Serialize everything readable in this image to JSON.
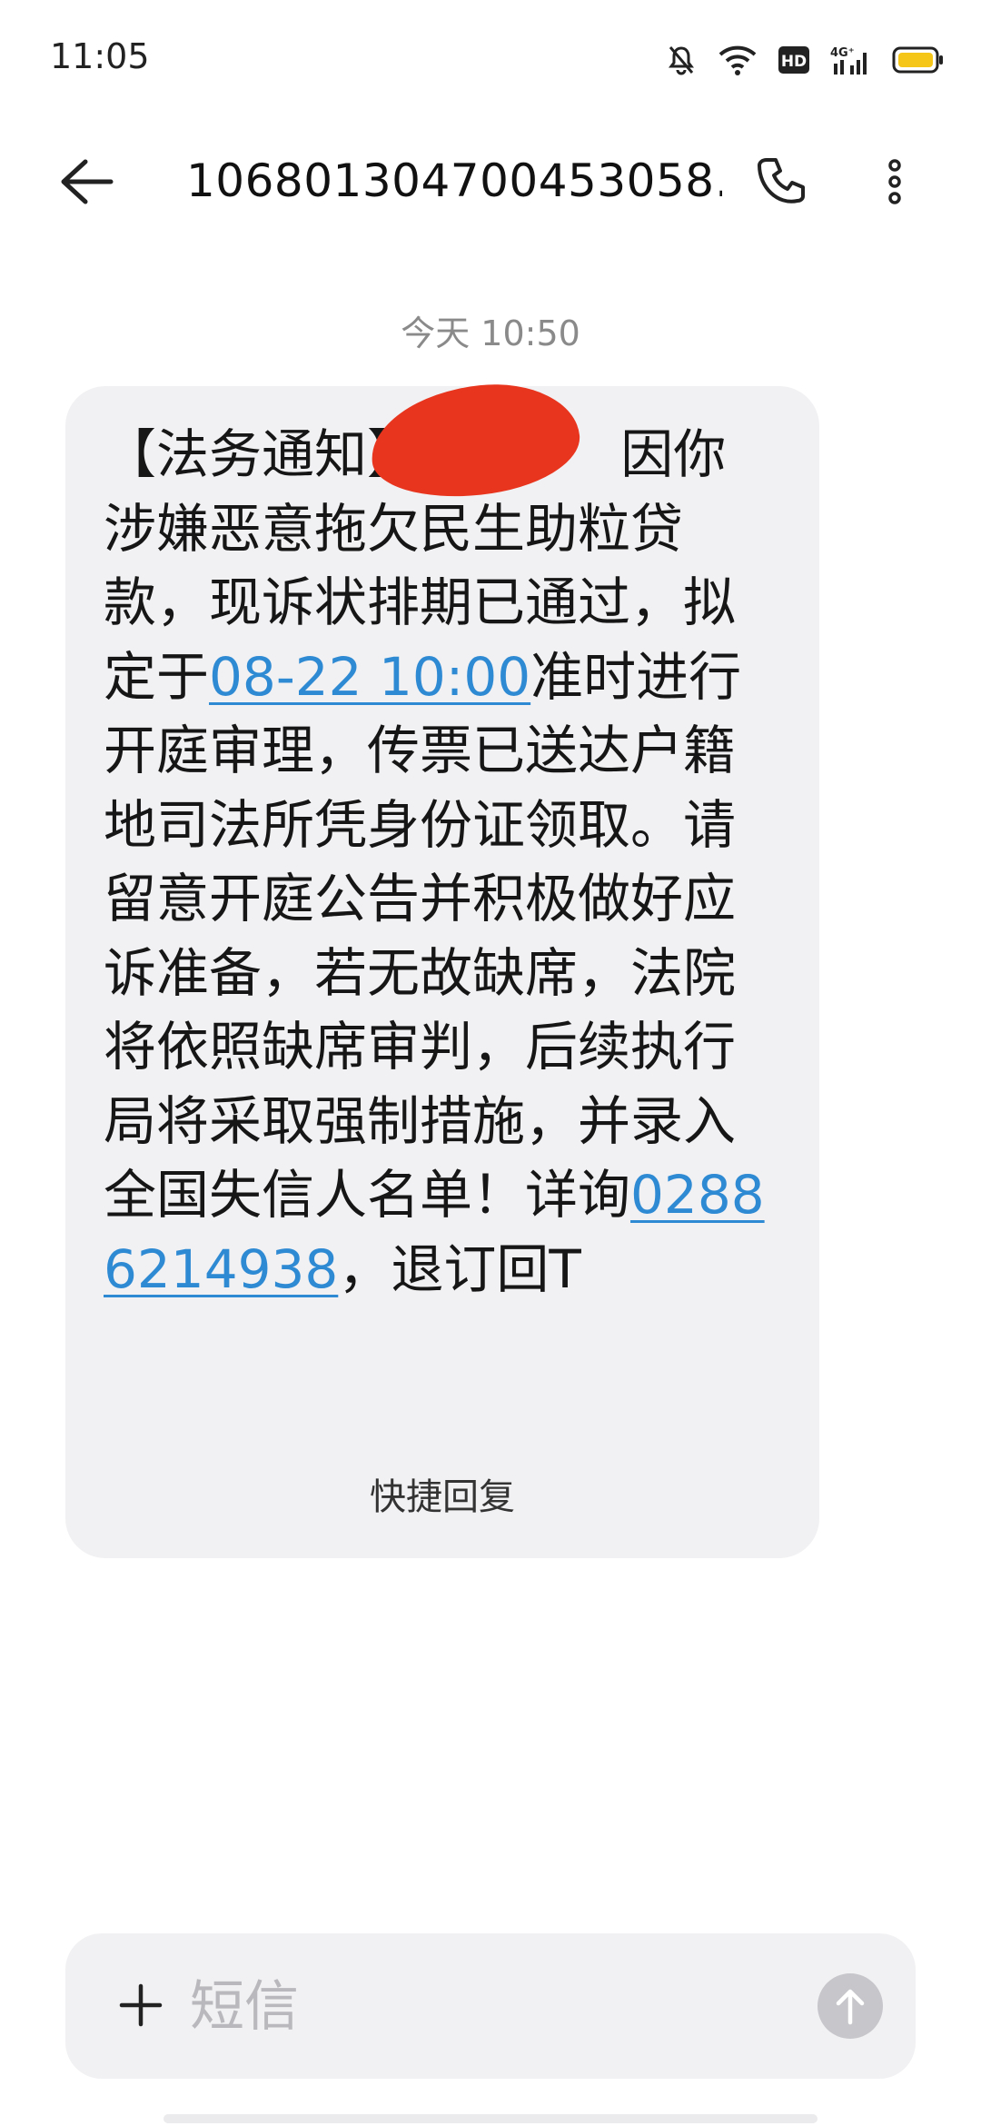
{
  "status_bar": {
    "time": "11:05",
    "icons": [
      "mute-bell-icon",
      "wifi-icon",
      "hd-icon",
      "signal-4g-icon",
      "battery-icon"
    ],
    "hd_label": "HD",
    "network_label": "4G⁺",
    "battery_color": "#f5c518"
  },
  "header": {
    "back_icon": "arrow-left-icon",
    "title": "106801304700453058…",
    "call_icon": "phone-icon",
    "more_icon": "more-vertical-icon"
  },
  "thread": {
    "date_separator": "今天 10:50",
    "message": {
      "segments": [
        {
          "text": "【法务通知】",
          "link": false
        },
        {
          "text": "            因你涉嫌恶意拖欠民生助粒贷款，现诉状排期已通过，拟定于",
          "link": false
        },
        {
          "text": "08-22 10:00",
          "link": true
        },
        {
          "text": "准时进行开庭审理，传票已送达户籍地司法所凭身份证领取。请留意开庭公告并积极做好应诉准备，若无故缺席，法院将依照缺席审判，后续执行局将采取强制措施，并录入全国失信人名单！详询",
          "link": false
        },
        {
          "text": "02886214938",
          "link": true
        },
        {
          "text": "，退订回T",
          "link": false
        }
      ],
      "link_color": "#2f8ad4",
      "redaction_color": "#e8351e"
    },
    "quick_reply_label": "快捷回复"
  },
  "composer": {
    "plus_icon": "plus-icon",
    "placeholder": "短信",
    "send_icon": "arrow-up-icon"
  }
}
